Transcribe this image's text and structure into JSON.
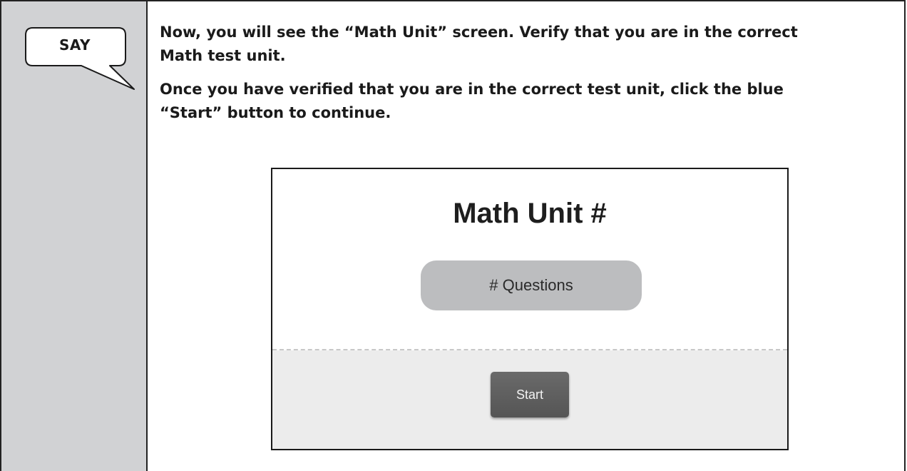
{
  "sidebar": {
    "bubble_label": "SAY"
  },
  "content": {
    "paragraphs": [
      "Now, you will see the “Math Unit” screen. Verify that you are in the correct Math test unit.",
      "Once you have verified that you are in the correct test unit, click the blue “Start” button to continue."
    ]
  },
  "screen": {
    "title": "Math Unit #",
    "questions_label": "# Questions",
    "start_label": "Start"
  },
  "colors": {
    "sidebar_bg": "#d1d2d4",
    "pill_bg": "#bcbdbf",
    "button_bg": "#5f5f5f",
    "footer_bg": "#ececec"
  }
}
